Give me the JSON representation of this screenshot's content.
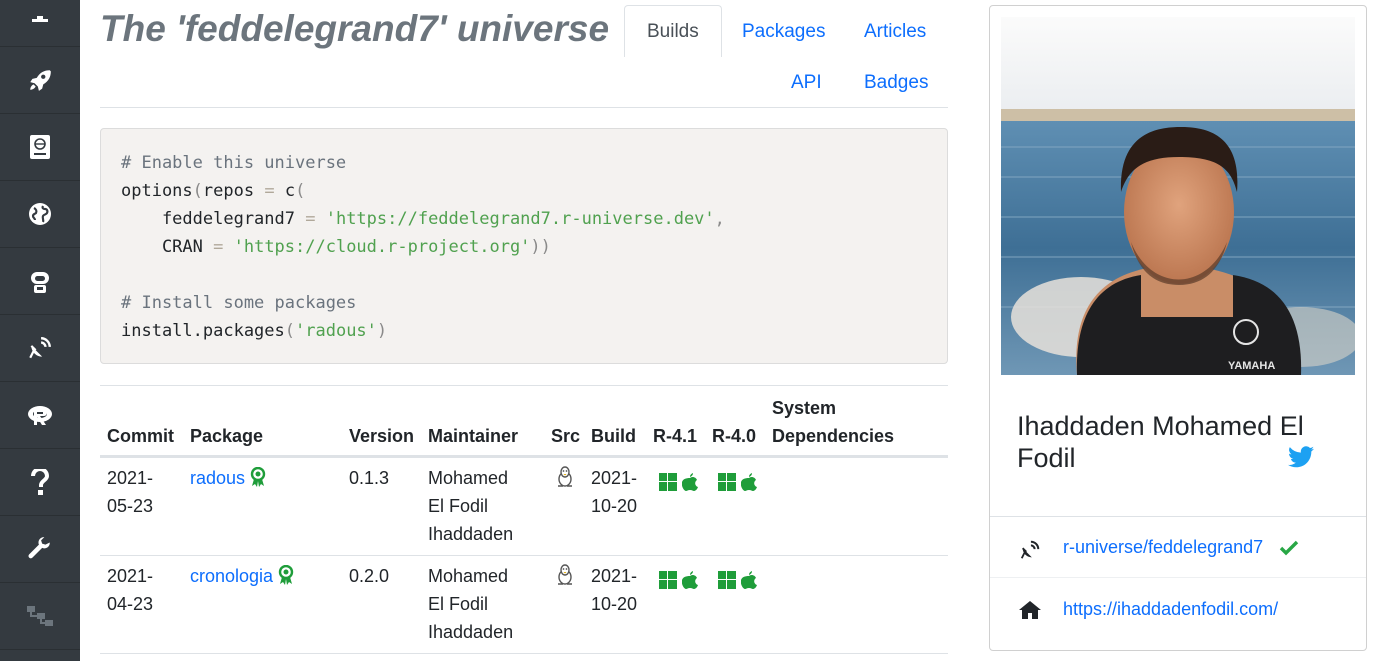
{
  "page": {
    "title": "The 'feddelegrand7' universe"
  },
  "sidebar": {
    "items": [
      {
        "icon": "home-icon"
      },
      {
        "icon": "rocket-icon"
      },
      {
        "icon": "book-icon"
      },
      {
        "icon": "globe-icon"
      },
      {
        "icon": "robot-icon"
      },
      {
        "icon": "satellite-dish-icon"
      },
      {
        "icon": "r-logo-icon"
      },
      {
        "icon": "question-icon"
      },
      {
        "icon": "wrench-icon"
      },
      {
        "icon": "sitemap-icon"
      }
    ]
  },
  "tabs": [
    {
      "label": "Builds",
      "active": true
    },
    {
      "label": "Packages",
      "active": false
    },
    {
      "label": "Articles",
      "active": false
    },
    {
      "label": "API",
      "active": false
    },
    {
      "label": "Badges",
      "active": false
    }
  ],
  "code": {
    "comment1": "# Enable this universe",
    "l2a": "options",
    "l2b": "(",
    "l2c": "repos",
    "l2d": " = ",
    "l2e": "c",
    "l2f": "(",
    "l3a": "    feddelegrand7",
    "l3b": " = ",
    "l3c": "'https://feddelegrand7.r-universe.dev'",
    "l3d": ",",
    "l4a": "    CRAN",
    "l4b": " = ",
    "l4c": "'https://cloud.r-project.org'",
    "l4d": "))",
    "comment2": "# Install some packages",
    "l7a": "install.packages",
    "l7b": "(",
    "l7c": "'radous'",
    "l7d": ")"
  },
  "table": {
    "headers": {
      "commit": "Commit",
      "package": "Package",
      "version": "Version",
      "maintainer": "Maintainer",
      "src": "Src",
      "build": "Build",
      "r41": "R-4.1",
      "r40": "R-4.0",
      "sysdeps1": "System",
      "sysdeps2": "Dependencies"
    },
    "rows": [
      {
        "commit1": "2021-",
        "commit2": "05-23",
        "package": "radous",
        "version": "0.1.3",
        "maint1": "Mohamed",
        "maint2": "El Fodil",
        "maint3": "Ihaddaden",
        "build1": "2021-",
        "build2": "10-20"
      },
      {
        "commit1": "2021-",
        "commit2": "04-23",
        "package": "cronologia",
        "version": "0.2.0",
        "maint1": "Mohamed",
        "maint2": "El Fodil",
        "maint3": "Ihaddaden",
        "build1": "2021-",
        "build2": "10-20"
      }
    ]
  },
  "profile": {
    "name": "Ihaddaden Mohamed El Fodil",
    "universe_link": "r-universe/feddelegrand7",
    "homepage": "https://ihaddadenfodil.com/",
    "photo_text": "YAMAHA"
  },
  "colors": {
    "sidebar_bg": "#343a40",
    "link": "#0d6efd",
    "check": "#28a745",
    "ok_green": "#1f9d3a",
    "twitter": "#1da1f2"
  }
}
